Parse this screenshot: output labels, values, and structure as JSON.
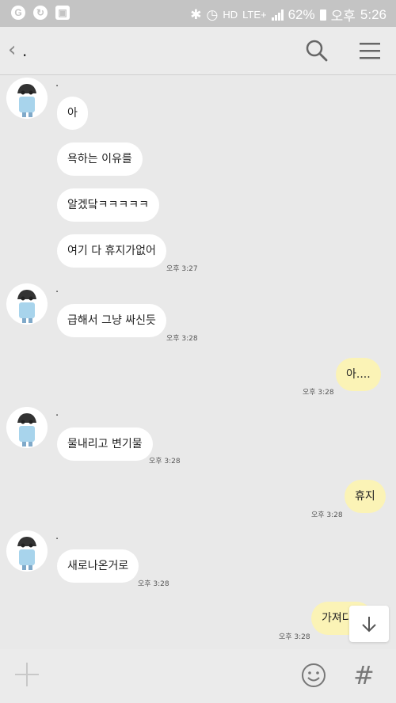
{
  "status_bar": {
    "left_icons": [
      "G",
      "↻",
      "▣"
    ],
    "bt": "✱",
    "alarm": "◷",
    "hd": "HD",
    "network": "LTE+",
    "battery": "62%",
    "ampm": "오후",
    "time": "5:26"
  },
  "header": {
    "back": "‹",
    "title": "."
  },
  "messages": {
    "g1_name": ".",
    "m1": "아",
    "m2": "욕하는 이유를",
    "m3": "알겠닼ㅋㅋㅋㅋㅋ",
    "m4": "여기 다 휴지가없어",
    "t4": "오후 3:27",
    "g2_name": ".",
    "m5": "급해서 그냥 싸신듯",
    "t5": "오후 3:28",
    "o1": "아....",
    "to1": "오후 3:28",
    "g3_name": ".",
    "m6": "물내리고 변기물",
    "t6": "오후 3:28",
    "o2": "휴지",
    "to2": "오후 3:28",
    "g4_name": ".",
    "m7": "새로나온거로",
    "t7": "오후 3:28",
    "o3": "가져다줘",
    "to3": "오후 3:28"
  },
  "bottom_bar": {
    "hash": "#"
  }
}
